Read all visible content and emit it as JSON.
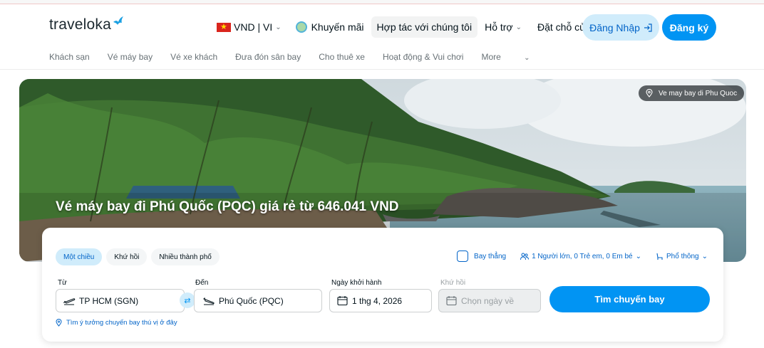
{
  "header": {
    "logo_text": "traveloka",
    "currency_lang": "VND | VI",
    "nav": {
      "promo": "Khuyến mãi",
      "partner": "Hợp tác với chúng tôi",
      "support": "Hỗ trợ",
      "bookings": "Đặt chỗ của tôi"
    },
    "login_label": "Đăng Nhập",
    "signup_label": "Đăng ký"
  },
  "subnav": {
    "items": [
      "Khách sạn",
      "Vé máy bay",
      "Vé xe khách",
      "Đưa đón sân bay",
      "Cho thuê xe",
      "Hoạt động & Vui chơi",
      "More"
    ]
  },
  "hero": {
    "title": "Vé máy bay đi Phú Quốc (PQC) giá rẻ từ 646.041 VND",
    "location_badge": "Ve may bay di Phu Quoc"
  },
  "search": {
    "tabs": [
      "Một chiều",
      "Khứ hồi",
      "Nhiều thành phố"
    ],
    "active_tab": "Một chiều",
    "direct_label": "Bay thẳng",
    "passengers": "1 Người lớn, 0 Trẻ em, 0 Em bé",
    "cabin": "Phổ thông",
    "from_label": "Từ",
    "from_value": "TP HCM (SGN)",
    "to_label": "Đến",
    "to_value": "Phú Quốc (PQC)",
    "depart_label": "Ngày khởi hành",
    "depart_value": "1 thg 4, 2026",
    "return_label": "Khứ hồi",
    "return_placeholder": "Chọn ngày về",
    "search_button": "Tìm chuyến bay",
    "idea_link": "Tìm ý tưởng chuyến bay thú vị ở đây"
  },
  "colors": {
    "brand_blue": "#0194f3",
    "link_blue": "#0264c8",
    "light_blue": "#d0ecfb"
  }
}
